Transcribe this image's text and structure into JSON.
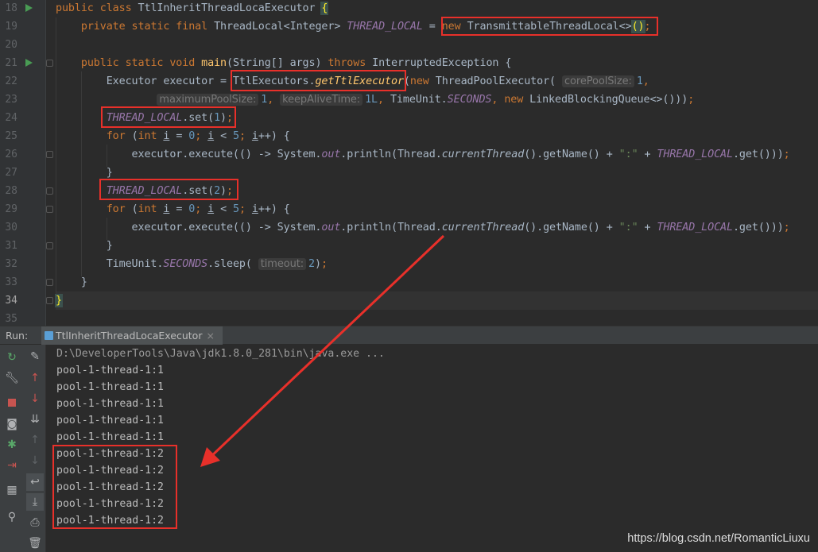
{
  "code_lines": [
    {
      "num": "18",
      "segs": [
        [
          "k",
          "public class "
        ],
        [
          "",
          "TtlInheritThreadLocaExecutor "
        ],
        [
          "brk",
          "{"
        ]
      ]
    },
    {
      "num": "19",
      "segs": [
        [
          "",
          "    "
        ],
        [
          "k",
          "private static final "
        ],
        [
          "",
          "ThreadLocal<Integer> "
        ],
        [
          "s",
          "THREAD_LOCAL"
        ],
        [
          "",
          " = "
        ],
        [
          "k",
          "new "
        ],
        [
          "",
          "TransmittableThreadLocal<>"
        ],
        [
          "brk",
          "()"
        ],
        [
          "k",
          ";"
        ]
      ]
    },
    {
      "num": "20",
      "segs": []
    },
    {
      "num": "21",
      "segs": [
        [
          "",
          "    "
        ],
        [
          "k",
          "public static void "
        ],
        [
          "f",
          "main"
        ],
        [
          "",
          "(String[] args) "
        ],
        [
          "k",
          "throws "
        ],
        [
          "",
          "InterruptedException {"
        ]
      ]
    },
    {
      "num": "22",
      "segs": [
        [
          "",
          "        Executor executor = TtlExecutors."
        ],
        [
          "fi",
          "getTtlExecutor"
        ],
        [
          "",
          "("
        ],
        [
          "k",
          "new "
        ],
        [
          "",
          "ThreadPoolExecutor( "
        ],
        [
          "hint",
          "corePoolSize:"
        ],
        [
          "n",
          "1"
        ],
        [
          "k",
          ","
        ]
      ]
    },
    {
      "num": "23",
      "segs": [
        [
          "",
          "                "
        ],
        [
          "hint",
          "maximumPoolSize:"
        ],
        [
          "n",
          "1"
        ],
        [
          "k",
          ", "
        ],
        [
          "hint",
          "keepAliveTime:"
        ],
        [
          "n",
          "1L"
        ],
        [
          "k",
          ", "
        ],
        [
          "",
          "TimeUnit."
        ],
        [
          "s",
          "SECONDS"
        ],
        [
          "k",
          ", "
        ],
        [
          "k",
          "new "
        ],
        [
          "",
          "LinkedBlockingQueue<>()))"
        ],
        [
          "k",
          ";"
        ]
      ]
    },
    {
      "num": "24",
      "segs": [
        [
          "",
          "        "
        ],
        [
          "s",
          "THREAD_LOCAL"
        ],
        [
          "",
          ".set("
        ],
        [
          "n",
          "1"
        ],
        [
          "",
          ")"
        ],
        [
          "k",
          ";"
        ]
      ]
    },
    {
      "num": "25",
      "segs": [
        [
          "",
          "        "
        ],
        [
          "k",
          "for "
        ],
        [
          "",
          "("
        ],
        [
          "k",
          "int "
        ],
        [
          "u",
          "i"
        ],
        [
          "",
          " = "
        ],
        [
          "n",
          "0"
        ],
        [
          "k",
          "; "
        ],
        [
          "u",
          "i"
        ],
        [
          "",
          " < "
        ],
        [
          "n",
          "5"
        ],
        [
          "k",
          "; "
        ],
        [
          "u",
          "i"
        ],
        [
          "",
          "++) {"
        ]
      ]
    },
    {
      "num": "26",
      "segs": [
        [
          "",
          "            executor.execute(() -> System."
        ],
        [
          "s",
          "out"
        ],
        [
          "",
          ".println(Thread."
        ],
        [
          "i",
          "currentThread"
        ],
        [
          "",
          "().getName() + "
        ],
        [
          "st",
          "\":\""
        ],
        [
          "",
          " + "
        ],
        [
          "s",
          "THREAD_LOCAL"
        ],
        [
          "",
          ".get()))"
        ],
        [
          "k",
          ";"
        ]
      ]
    },
    {
      "num": "27",
      "segs": [
        [
          "",
          "        }"
        ]
      ]
    },
    {
      "num": "28",
      "segs": [
        [
          "",
          "        "
        ],
        [
          "s",
          "THREAD_LOCAL"
        ],
        [
          "",
          ".set("
        ],
        [
          "n",
          "2"
        ],
        [
          "",
          ")"
        ],
        [
          "k",
          ";"
        ]
      ]
    },
    {
      "num": "29",
      "segs": [
        [
          "",
          "        "
        ],
        [
          "k",
          "for "
        ],
        [
          "",
          "("
        ],
        [
          "k",
          "int "
        ],
        [
          "u",
          "i"
        ],
        [
          "",
          " = "
        ],
        [
          "n",
          "0"
        ],
        [
          "k",
          "; "
        ],
        [
          "u",
          "i"
        ],
        [
          "",
          " < "
        ],
        [
          "n",
          "5"
        ],
        [
          "k",
          "; "
        ],
        [
          "u",
          "i"
        ],
        [
          "",
          "++) {"
        ]
      ]
    },
    {
      "num": "30",
      "segs": [
        [
          "",
          "            executor.execute(() -> System."
        ],
        [
          "s",
          "out"
        ],
        [
          "",
          ".println(Thread."
        ],
        [
          "i",
          "currentThread"
        ],
        [
          "",
          "().getName() + "
        ],
        [
          "st",
          "\":\""
        ],
        [
          "",
          " + "
        ],
        [
          "s",
          "THREAD_LOCAL"
        ],
        [
          "",
          ".get()))"
        ],
        [
          "k",
          ";"
        ]
      ]
    },
    {
      "num": "31",
      "segs": [
        [
          "",
          "        }"
        ]
      ]
    },
    {
      "num": "32",
      "segs": [
        [
          "",
          "        TimeUnit."
        ],
        [
          "s",
          "SECONDS"
        ],
        [
          "",
          ".sleep( "
        ],
        [
          "hint",
          "timeout:"
        ],
        [
          "n",
          "2"
        ],
        [
          "",
          ")"
        ],
        [
          "k",
          ";"
        ]
      ]
    },
    {
      "num": "33",
      "segs": [
        [
          "",
          "    }"
        ]
      ]
    },
    {
      "num": "34",
      "segs": [
        [
          "brk",
          "}"
        ]
      ]
    },
    {
      "num": "35",
      "segs": []
    }
  ],
  "run_panel": {
    "label": "Run:",
    "tab_title": "TtlInheritThreadLocaExecutor",
    "tab_close": "×"
  },
  "console_lines": [
    "D:\\DeveloperTools\\Java\\jdk1.8.0_281\\bin\\java.exe ...",
    "pool-1-thread-1:1",
    "pool-1-thread-1:1",
    "pool-1-thread-1:1",
    "pool-1-thread-1:1",
    "pool-1-thread-1:1",
    "pool-1-thread-1:2",
    "pool-1-thread-1:2",
    "pool-1-thread-1:2",
    "pool-1-thread-1:2",
    "pool-1-thread-1:2"
  ],
  "watermark": "https://blog.csdn.net/RomanticLiuxu",
  "colors": {
    "highlight": "#e8302a",
    "keyword": "#cc7832",
    "constant": "#9876aa",
    "number": "#6897bb"
  }
}
